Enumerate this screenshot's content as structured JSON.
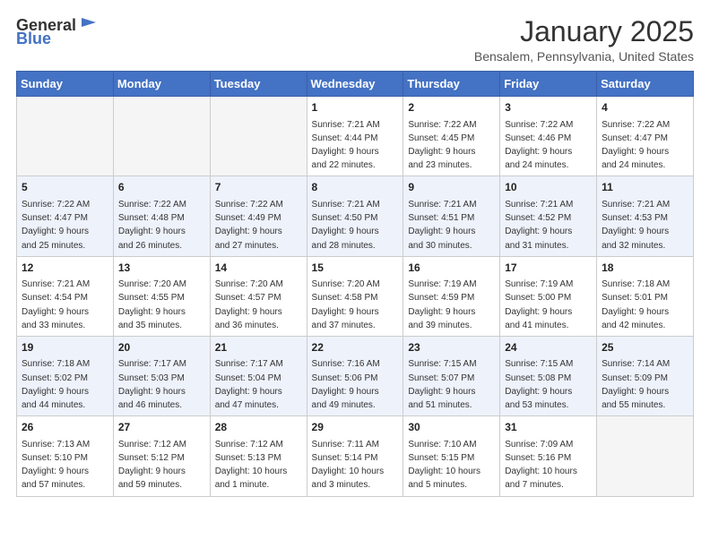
{
  "header": {
    "logo_general": "General",
    "logo_blue": "Blue",
    "month_title": "January 2025",
    "location": "Bensalem, Pennsylvania, United States"
  },
  "days_of_week": [
    "Sunday",
    "Monday",
    "Tuesday",
    "Wednesday",
    "Thursday",
    "Friday",
    "Saturday"
  ],
  "weeks": [
    [
      {
        "day": "",
        "info": ""
      },
      {
        "day": "",
        "info": ""
      },
      {
        "day": "",
        "info": ""
      },
      {
        "day": "1",
        "info": "Sunrise: 7:21 AM\nSunset: 4:44 PM\nDaylight: 9 hours\nand 22 minutes."
      },
      {
        "day": "2",
        "info": "Sunrise: 7:22 AM\nSunset: 4:45 PM\nDaylight: 9 hours\nand 23 minutes."
      },
      {
        "day": "3",
        "info": "Sunrise: 7:22 AM\nSunset: 4:46 PM\nDaylight: 9 hours\nand 24 minutes."
      },
      {
        "day": "4",
        "info": "Sunrise: 7:22 AM\nSunset: 4:47 PM\nDaylight: 9 hours\nand 24 minutes."
      }
    ],
    [
      {
        "day": "5",
        "info": "Sunrise: 7:22 AM\nSunset: 4:47 PM\nDaylight: 9 hours\nand 25 minutes."
      },
      {
        "day": "6",
        "info": "Sunrise: 7:22 AM\nSunset: 4:48 PM\nDaylight: 9 hours\nand 26 minutes."
      },
      {
        "day": "7",
        "info": "Sunrise: 7:22 AM\nSunset: 4:49 PM\nDaylight: 9 hours\nand 27 minutes."
      },
      {
        "day": "8",
        "info": "Sunrise: 7:21 AM\nSunset: 4:50 PM\nDaylight: 9 hours\nand 28 minutes."
      },
      {
        "day": "9",
        "info": "Sunrise: 7:21 AM\nSunset: 4:51 PM\nDaylight: 9 hours\nand 30 minutes."
      },
      {
        "day": "10",
        "info": "Sunrise: 7:21 AM\nSunset: 4:52 PM\nDaylight: 9 hours\nand 31 minutes."
      },
      {
        "day": "11",
        "info": "Sunrise: 7:21 AM\nSunset: 4:53 PM\nDaylight: 9 hours\nand 32 minutes."
      }
    ],
    [
      {
        "day": "12",
        "info": "Sunrise: 7:21 AM\nSunset: 4:54 PM\nDaylight: 9 hours\nand 33 minutes."
      },
      {
        "day": "13",
        "info": "Sunrise: 7:20 AM\nSunset: 4:55 PM\nDaylight: 9 hours\nand 35 minutes."
      },
      {
        "day": "14",
        "info": "Sunrise: 7:20 AM\nSunset: 4:57 PM\nDaylight: 9 hours\nand 36 minutes."
      },
      {
        "day": "15",
        "info": "Sunrise: 7:20 AM\nSunset: 4:58 PM\nDaylight: 9 hours\nand 37 minutes."
      },
      {
        "day": "16",
        "info": "Sunrise: 7:19 AM\nSunset: 4:59 PM\nDaylight: 9 hours\nand 39 minutes."
      },
      {
        "day": "17",
        "info": "Sunrise: 7:19 AM\nSunset: 5:00 PM\nDaylight: 9 hours\nand 41 minutes."
      },
      {
        "day": "18",
        "info": "Sunrise: 7:18 AM\nSunset: 5:01 PM\nDaylight: 9 hours\nand 42 minutes."
      }
    ],
    [
      {
        "day": "19",
        "info": "Sunrise: 7:18 AM\nSunset: 5:02 PM\nDaylight: 9 hours\nand 44 minutes."
      },
      {
        "day": "20",
        "info": "Sunrise: 7:17 AM\nSunset: 5:03 PM\nDaylight: 9 hours\nand 46 minutes."
      },
      {
        "day": "21",
        "info": "Sunrise: 7:17 AM\nSunset: 5:04 PM\nDaylight: 9 hours\nand 47 minutes."
      },
      {
        "day": "22",
        "info": "Sunrise: 7:16 AM\nSunset: 5:06 PM\nDaylight: 9 hours\nand 49 minutes."
      },
      {
        "day": "23",
        "info": "Sunrise: 7:15 AM\nSunset: 5:07 PM\nDaylight: 9 hours\nand 51 minutes."
      },
      {
        "day": "24",
        "info": "Sunrise: 7:15 AM\nSunset: 5:08 PM\nDaylight: 9 hours\nand 53 minutes."
      },
      {
        "day": "25",
        "info": "Sunrise: 7:14 AM\nSunset: 5:09 PM\nDaylight: 9 hours\nand 55 minutes."
      }
    ],
    [
      {
        "day": "26",
        "info": "Sunrise: 7:13 AM\nSunset: 5:10 PM\nDaylight: 9 hours\nand 57 minutes."
      },
      {
        "day": "27",
        "info": "Sunrise: 7:12 AM\nSunset: 5:12 PM\nDaylight: 9 hours\nand 59 minutes."
      },
      {
        "day": "28",
        "info": "Sunrise: 7:12 AM\nSunset: 5:13 PM\nDaylight: 10 hours\nand 1 minute."
      },
      {
        "day": "29",
        "info": "Sunrise: 7:11 AM\nSunset: 5:14 PM\nDaylight: 10 hours\nand 3 minutes."
      },
      {
        "day": "30",
        "info": "Sunrise: 7:10 AM\nSunset: 5:15 PM\nDaylight: 10 hours\nand 5 minutes."
      },
      {
        "day": "31",
        "info": "Sunrise: 7:09 AM\nSunset: 5:16 PM\nDaylight: 10 hours\nand 7 minutes."
      },
      {
        "day": "",
        "info": ""
      }
    ]
  ]
}
